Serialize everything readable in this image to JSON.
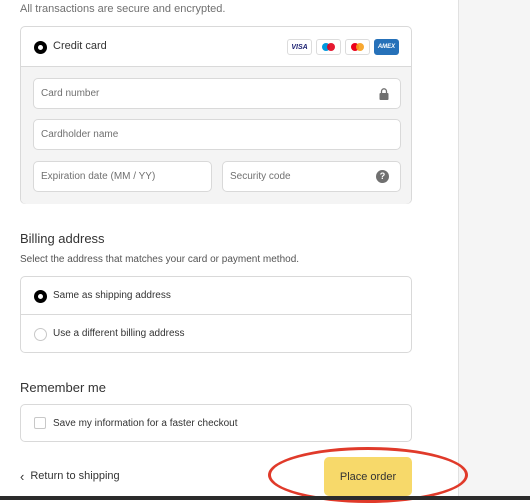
{
  "secure_note": "All transactions are secure and encrypted.",
  "payment": {
    "credit_card_label": "Credit card",
    "brands": [
      {
        "name": "VISA",
        "icon": "visa-icon"
      },
      {
        "name": "",
        "icon": "maestro-icon"
      },
      {
        "name": "",
        "icon": "mastercard-icon"
      },
      {
        "name": "AMEX",
        "icon": "amex-icon"
      }
    ],
    "card_number_placeholder": "Card number",
    "cardholder_placeholder": "Cardholder name",
    "expiry_placeholder": "Expiration date (MM / YY)",
    "security_placeholder": "Security code",
    "help_glyph": "?"
  },
  "billing": {
    "title": "Billing address",
    "subtitle": "Select the address that matches your card or payment method.",
    "options": [
      {
        "label": "Same as shipping address",
        "selected": true
      },
      {
        "label": "Use a different billing address",
        "selected": false
      }
    ]
  },
  "remember": {
    "title": "Remember me",
    "label": "Save my information for a faster checkout"
  },
  "footer": {
    "return_label": "Return to shipping",
    "place_order_label": "Place order"
  },
  "colors": {
    "accent_button": "#f7d96a",
    "highlight": "#e03a2a"
  }
}
